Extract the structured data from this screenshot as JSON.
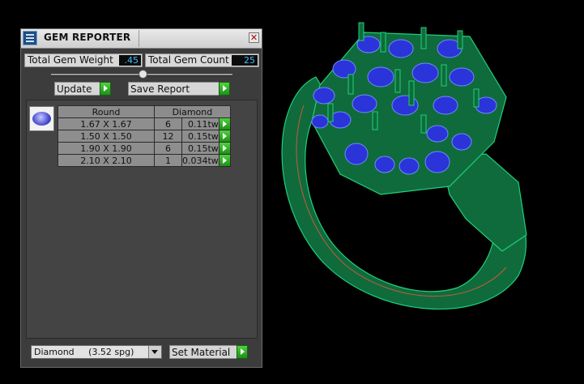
{
  "window": {
    "title": "GEM REPORTER"
  },
  "stats": {
    "weight_label": "Total Gem Weight",
    "weight_value": ".45",
    "count_label": "Total Gem Count",
    "count_value": "25"
  },
  "buttons": {
    "update": "Update",
    "save_report": "Save Report",
    "set_material": "Set Material"
  },
  "table": {
    "headers": [
      "Round",
      "Diamond"
    ],
    "rows": [
      {
        "size": "1.67 X 1.67",
        "count": "6",
        "weight": "0.11tw"
      },
      {
        "size": "1.50 X 1.50",
        "count": "12",
        "weight": "0.15tw"
      },
      {
        "size": "1.90 X 1.90",
        "count": "6",
        "weight": "0.15tw"
      },
      {
        "size": "2.10 X 2.10",
        "count": "1",
        "weight": "0.034tw"
      }
    ]
  },
  "material": {
    "selected": "Diamond     (3.52 spg)"
  },
  "colors": {
    "wireframe": "#1fd07a",
    "gems": "#2b34d8",
    "background": "#000000",
    "value_text": "#3ec0ff"
  }
}
